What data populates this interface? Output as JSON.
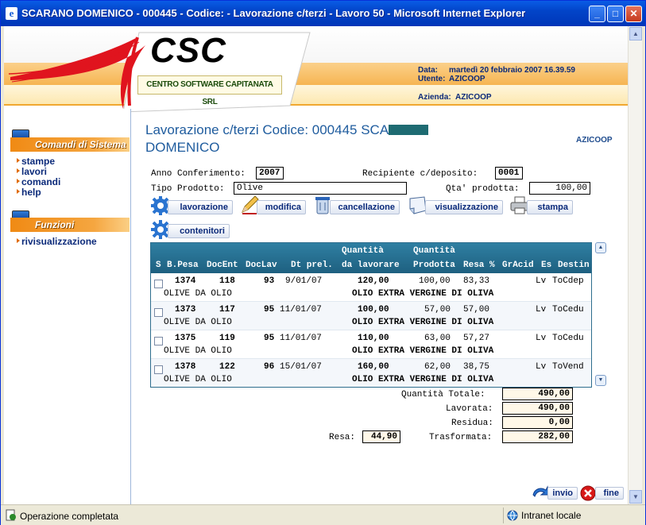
{
  "window": {
    "title": "SCARANO DOMENICO - 000445 - Codice: - Lavorazione c/terzi - Lavoro 50 - Microsoft Internet Explorer",
    "minimize": "_",
    "maximize": "□",
    "close": "✕"
  },
  "header": {
    "logo_text": "CSC",
    "logo_subtitle": "CENTRO SOFTWARE CAPITANATA SRL",
    "date_label": "Data:",
    "date_value": "martedì 20 febbraio 2007 16.39.59",
    "user_label": "Utente:",
    "user_value": "AZICOOP",
    "company_label": "Azienda:",
    "company_value": "AZICOOP"
  },
  "sidebar": {
    "system_title": "Comandi di Sistema",
    "system_items": [
      "stampe",
      "lavori",
      "comandi",
      "help"
    ],
    "functions_title": "Funzioni",
    "function_items": [
      "rivisualizzazione"
    ]
  },
  "page": {
    "title_line1": "Lavorazione c/terzi Codice: 000445 SCA",
    "title_line2": "DOMENICO",
    "company_tag": "AZICOOP"
  },
  "form": {
    "anno_label": "Anno Conferimento:",
    "anno_value": "2007",
    "recipiente_label": "Recipiente c/deposito:",
    "recipiente_value": "0001",
    "tipo_label": "Tipo Prodotto:",
    "tipo_value": "Olive",
    "qta_label": "Qta' prodotta:",
    "qta_value": "100,00"
  },
  "toolbar": {
    "lavorazione": "lavorazione",
    "modifica": "modifica",
    "cancellazione": "cancellazione",
    "visualizzazione": "visualizzazione",
    "stampa": "stampa",
    "contenitori": "contenitori"
  },
  "grid": {
    "headers_top": {
      "quantita1": "Quantità",
      "quantita2": "Quantità"
    },
    "headers": {
      "s": "S",
      "bpesa": "B.Pesa",
      "docent": "DocEnt",
      "doclav": "DocLav",
      "dtprel": "Dt prel.",
      "dalavorare": "da lavorare",
      "prodotta": "Prodotta",
      "resa": "Resa %",
      "gracid": "GrAcid",
      "es": "Es",
      "destin": "Destin"
    },
    "rows": [
      {
        "bpesa": "1374",
        "docent": "118",
        "doclav": "93",
        "dtprel": "9/01/07",
        "dalavorare": "120,00",
        "prodotta": "100,00",
        "resa": "83,33",
        "gracid": "",
        "es": "Lv",
        "destin": "ToCdep",
        "desc1": "OLIVE DA OLIO",
        "desc2": "OLIO EXTRA VERGINE DI OLIVA"
      },
      {
        "bpesa": "1373",
        "docent": "117",
        "doclav": "95",
        "dtprel": "11/01/07",
        "dalavorare": "100,00",
        "prodotta": "57,00",
        "resa": "57,00",
        "gracid": "",
        "es": "Lv",
        "destin": "ToCedu",
        "desc1": "OLIVE DA OLIO",
        "desc2": "OLIO EXTRA VERGINE DI OLIVA"
      },
      {
        "bpesa": "1375",
        "docent": "119",
        "doclav": "95",
        "dtprel": "11/01/07",
        "dalavorare": "110,00",
        "prodotta": "63,00",
        "resa": "57,27",
        "gracid": "",
        "es": "Lv",
        "destin": "ToCedu",
        "desc1": "OLIVE DA OLIO",
        "desc2": "OLIO EXTRA VERGINE DI OLIVA"
      },
      {
        "bpesa": "1378",
        "docent": "122",
        "doclav": "96",
        "dtprel": "15/01/07",
        "dalavorare": "160,00",
        "prodotta": "62,00",
        "resa": "38,75",
        "gracid": "",
        "es": "Lv",
        "destin": "ToVend",
        "desc1": "OLIVE DA OLIO",
        "desc2": "OLIO EXTRA VERGINE DI OLIVA"
      }
    ]
  },
  "totals": {
    "totale_label": "Quantità  Totale:",
    "totale_value": "490,00",
    "lavorata_label": "Lavorata:",
    "lavorata_value": "490,00",
    "residua_label": "Residua:",
    "residua_value": "0,00",
    "resa_label": "Resa:",
    "resa_value": "44,90",
    "trasformata_label": "Trasformata:",
    "trasformata_value": "282,00"
  },
  "footer_buttons": {
    "invio": "invio",
    "fine": "fine"
  },
  "statusbar": {
    "status": "Operazione completata",
    "zone": "Intranet locale"
  }
}
